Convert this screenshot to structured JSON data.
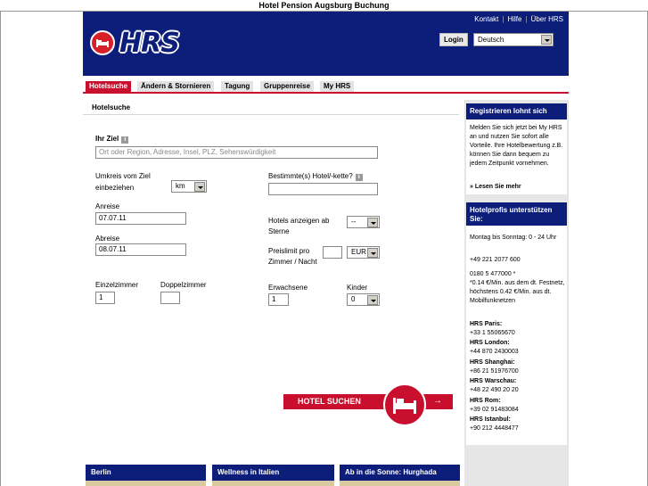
{
  "window": {
    "title": "Hotel Pension Augsburg Buchung"
  },
  "header": {
    "logo_text": "HRS",
    "links": [
      "Kontakt",
      "Hilfe",
      "Über HRS"
    ],
    "login_label": "Login",
    "language": "Deutsch"
  },
  "tabs": [
    {
      "label": "Hotelsuche",
      "active": true
    },
    {
      "label": "Ändern & Stornieren",
      "active": false
    },
    {
      "label": "Tagung",
      "active": false
    },
    {
      "label": "Gruppenreise",
      "active": false
    },
    {
      "label": "My HRS",
      "active": false
    }
  ],
  "search": {
    "section_title": "Hotelsuche",
    "destination_label": "Ihr Ziel",
    "destination_placeholder": "Ort oder Region, Adresse, Insel, PLZ, Sehenswürdigkeit",
    "radius_label_1": "Umkreis vom Ziel",
    "radius_label_2": "einbeziehen",
    "radius_unit": "km",
    "chain_label": "Bestimmte(s) Hotel/-kette?",
    "arrival_label": "Anreise",
    "arrival_value": "07.07.11",
    "departure_label": "Abreise",
    "departure_value": "08.07.11",
    "stars_label_1": "Hotels anzeigen ab",
    "stars_label_2": "Sterne",
    "stars_value": "--",
    "price_label_1": "Preislimit pro",
    "price_label_2": "Zimmer / Nacht",
    "currency": "EUR",
    "single_label": "Einzelzimmer",
    "single_value": "1",
    "double_label": "Doppelzimmer",
    "double_value": "",
    "adults_label": "Erwachsene",
    "adults_value": "1",
    "children_label": "Kinder",
    "children_value": "0",
    "submit_label": "HOTEL SUCHEN",
    "submit_arrow": "→"
  },
  "sidebar": {
    "register_title": "Registrieren lohnt sich",
    "register_text": "Melden Sie sich jetzt bei My HRS an und nutzen Sie sofort alle Vorteile. Ihre Hotelbewertung z.B. können Sie dann bequem zu jedem Zeitpunkt vornehmen.",
    "register_link": "» Lesen Sie mehr",
    "support_title": "Hotelprofis unterstützen Sie:",
    "hours": "Montag bis Sonntag: 0 - 24 Uhr",
    "phone_de": "+49 221 2077 600",
    "phone_premium": "0180 5 477000 *",
    "premium_note": "*0.14 €/Min. aus dem dt. Festnetz, höchstens 0.42 €/Min. aus dt. Mobilfunknetzen",
    "offices": [
      {
        "city": "HRS Paris:",
        "phone": "+33 1 55065670"
      },
      {
        "city": "HRS London:",
        "phone": "+44 870 2430003"
      },
      {
        "city": "HRS Shanghai:",
        "phone": "+86 21 51976700"
      },
      {
        "city": "HRS Warschau:",
        "phone": "+48 22 490 20 20"
      },
      {
        "city": "HRS Rom:",
        "phone": "+39 02 91483084"
      },
      {
        "city": "HRS Istanbul:",
        "phone": "+90 212 4448477"
      }
    ]
  },
  "promos": [
    "Berlin",
    "Wellness in Italien",
    "Ab in die Sonne: Hurghada"
  ],
  "colors": {
    "brand_blue": "#0c1e7a",
    "brand_red": "#c8102e",
    "sidebar_bg": "#e6e6e6"
  }
}
